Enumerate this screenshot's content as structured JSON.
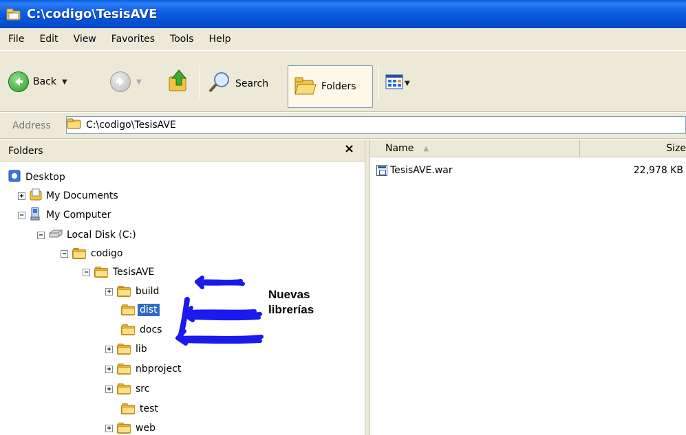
{
  "window": {
    "title": "C:\\codigo\\TesisAVE"
  },
  "menu": [
    "File",
    "Edit",
    "View",
    "Favorites",
    "Tools",
    "Help"
  ],
  "toolbar": {
    "back_label": "Back",
    "search_label": "Search",
    "folders_label": "Folders"
  },
  "address": {
    "label": "Address",
    "value": "C:\\codigo\\TesisAVE"
  },
  "folders_pane": {
    "title": "Folders",
    "close": "×",
    "tree": [
      {
        "label": "Desktop"
      },
      {
        "label": "My Documents",
        "expander": "+"
      },
      {
        "label": "My Computer",
        "expander": "−"
      },
      {
        "label": "Local Disk (C:)",
        "expander": "−"
      },
      {
        "label": "codigo",
        "expander": "−"
      },
      {
        "label": "TesisAVE",
        "expander": "−"
      },
      {
        "label": "build",
        "expander": "+"
      },
      {
        "label": "dist",
        "selected": true
      },
      {
        "label": "docs"
      },
      {
        "label": "lib",
        "expander": "+"
      },
      {
        "label": "nbproject",
        "expander": "+"
      },
      {
        "label": "src",
        "expander": "+"
      },
      {
        "label": "test"
      },
      {
        "label": "web",
        "expander": "+"
      }
    ]
  },
  "annotation": {
    "line1": "Nuevas",
    "line2": "librerías"
  },
  "list_pane": {
    "columns": {
      "name": "Name",
      "size": "Size"
    },
    "files": [
      {
        "name": "TesisAVE.war",
        "size": "22,978 KB"
      }
    ]
  },
  "colors": {
    "title_bar": "#0554d9",
    "selection": "#316ac5",
    "chrome": "#ece9d8",
    "scribble": "#1a1aee"
  }
}
